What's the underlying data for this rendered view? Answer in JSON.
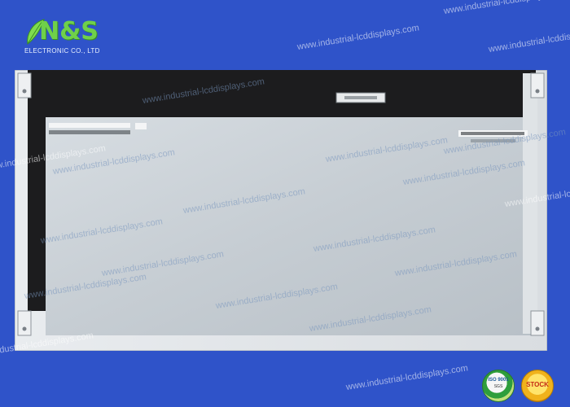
{
  "logo": {
    "mark": "N&S",
    "subtitle": "ELECTRONIC CO., LTD"
  },
  "watermark": {
    "text": "www.industrial-lcddisplays.com"
  },
  "panel": {
    "top_label_left": "M215HW03 V1 HW:2A",
    "top_label_right": "",
    "colors": {
      "bezel": "#1c1c1e",
      "back_cover": "#c9d0d6",
      "frame": "#e4e7ea"
    }
  },
  "badges": {
    "iso": {
      "title": "ISO 9001",
      "sub": "SGS"
    },
    "stock": {
      "title": "STOCK"
    }
  },
  "colors": {
    "background": "#2f53c9",
    "logo_green": "#6fd04a"
  }
}
